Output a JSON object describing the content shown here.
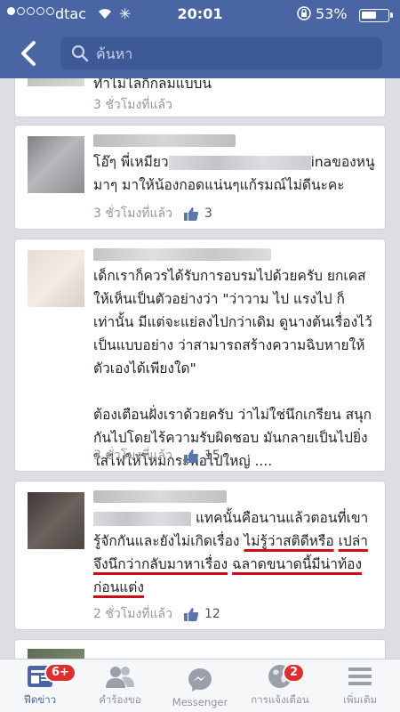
{
  "status_bar": {
    "carrier": "dtac",
    "time": "20:01",
    "battery": "53%"
  },
  "header": {
    "search_placeholder": "ค้นหา"
  },
  "posts": [
    {
      "text": [
        "ทำไม่ไลก็กลมแบบน"
      ],
      "time": "3 ชั่วโมงที่แล้ว"
    },
    {
      "text_a": "โอ๊ๆ พี่เหมียว",
      "text_b": "inaของหนู มาๆ มาให้น้องกอดแน่นๆแก้รมณ์ไม่ดีนะคะ",
      "time": "3 ชั่วโมงที่แล้ว",
      "likes": "3"
    },
    {
      "paragraphs": [
        "เด็กเราก็ควรได้รับการอบรมไปด้วยครับ  ยกเคสให้เห็นเป็นตัวอย่างว่า \"ว่าวาม ไป แรงไป ก็เท่านั้น  มีแต่จะแย่ลงไปกว่าเดิม  ดูนางต้นเรื่องไว้เป็นแบบอย่าง ว่าสามารถสร้างความฉิบหายให้ตัวเองได้เพียงใด\"",
        "ต้องเตือนฝั่งเราด้วยครับ ว่าไม่ใช่นึกเกรียน สนุกกันไปโดยไร้ความรับผิดชอบ มันกลายเป็นไปยิ่งใส่ไฟให้โหมกระพือไปใหญ่ ...."
      ],
      "time": "3 ชั่วโมงที่แล้ว",
      "likes": "15"
    },
    {
      "text_a": "แทคนั้นคือนานแล้วตอนที่เขารู้จักกันและยังไม่เกิดเรื่อง ",
      "text_ul1": "ไม่รู้ว่าสติดีหรือ",
      "text_ul2": "เปล่าจึงนึกว่ากลับมาหาเรื่อง",
      "text_c": " ",
      "text_ul3": "ฉลาดขนาดนี้มีน่าท้องก่อนแต่ง",
      "time": "2 ชั่วโมงที่แล้ว",
      "likes": "12"
    }
  ],
  "tabs": [
    {
      "label": "ฟีดข่าว",
      "icon": "news-feed-icon",
      "badge": "6+",
      "active": true
    },
    {
      "label": "คำร้องขอ",
      "icon": "friend-requests-icon"
    },
    {
      "label": "Messenger",
      "icon": "messenger-icon"
    },
    {
      "label": "การแจ้งเตือน",
      "icon": "globe-notifications-icon",
      "badge": "2"
    },
    {
      "label": "เพิ่มเติม",
      "icon": "more-menu-icon"
    }
  ],
  "colors": {
    "header": "#4a65a3",
    "accent": "#4a65a3",
    "badge": "#e12d2d",
    "underline": "#d20b16"
  }
}
